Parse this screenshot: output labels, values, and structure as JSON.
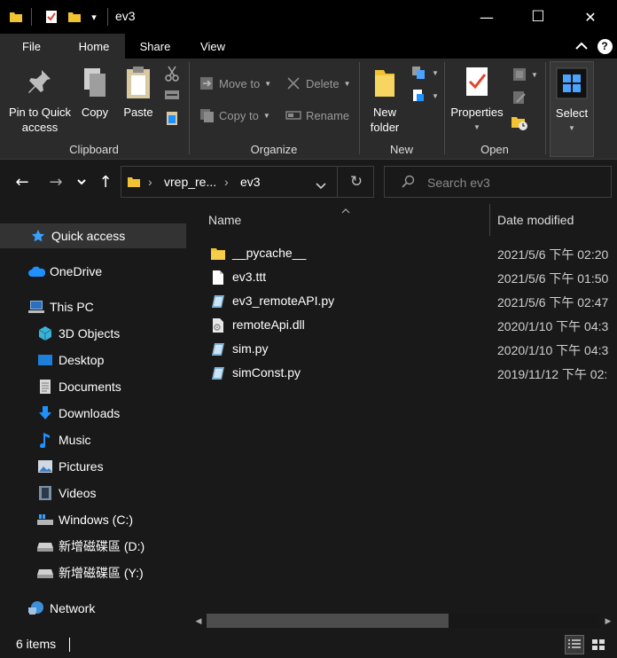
{
  "window": {
    "title": "ev3",
    "minimize_glyph": "—",
    "maximize_glyph": "☐",
    "close_glyph": "✕"
  },
  "quick_access_toolbar": {
    "icons": [
      "folder-icon",
      "properties-check-icon",
      "new-folder-icon",
      "customize-dropdown-icon"
    ],
    "customize_glyph": "▾"
  },
  "tabs": [
    {
      "label": "File"
    },
    {
      "label": "Home"
    },
    {
      "label": "Share"
    },
    {
      "label": "View"
    }
  ],
  "ribbon_controls": {
    "collapse_glyph": "^",
    "help_glyph": "?"
  },
  "ribbon": {
    "clipboard": {
      "label": "Clipboard",
      "pin_label": "Pin to Quick access",
      "copy_label": "Copy",
      "paste_label": "Paste"
    },
    "organize": {
      "label": "Organize",
      "move_to": "Move to",
      "copy_to": "Copy to",
      "delete": "Delete",
      "rename": "Rename"
    },
    "new": {
      "label": "New",
      "new_folder": "New folder"
    },
    "open": {
      "label": "Open",
      "properties": "Properties"
    },
    "select": {
      "label": "Select"
    }
  },
  "navigation": {
    "back_glyph": "←",
    "forward_glyph": "→",
    "recent_glyph": "⌄",
    "up_glyph": "↑",
    "breadcrumb": [
      "vrep_re...",
      "ev3"
    ],
    "breadcrumb_sep": "›",
    "refresh_glyph": "↻",
    "search_placeholder": "Search ev3"
  },
  "nav_pane": {
    "items": [
      {
        "label": "Quick access",
        "icon": "star-icon"
      },
      {
        "label": "OneDrive",
        "icon": "cloud-icon"
      },
      {
        "label": "This PC",
        "icon": "computer-icon"
      },
      {
        "label": "3D Objects",
        "icon": "cube-icon"
      },
      {
        "label": "Desktop",
        "icon": "desktop-icon"
      },
      {
        "label": "Documents",
        "icon": "document-icon"
      },
      {
        "label": "Downloads",
        "icon": "download-icon"
      },
      {
        "label": "Music",
        "icon": "music-icon"
      },
      {
        "label": "Pictures",
        "icon": "pictures-icon"
      },
      {
        "label": "Videos",
        "icon": "video-icon"
      },
      {
        "label": "Windows (C:)",
        "icon": "drive-c-icon"
      },
      {
        "label": "新增磁碟區 (D:)",
        "icon": "drive-icon"
      },
      {
        "label": "新增磁碟區 (Y:)",
        "icon": "drive-icon"
      },
      {
        "label": "Network",
        "icon": "network-icon"
      }
    ]
  },
  "columns": {
    "name": "Name",
    "date_modified": "Date modified",
    "sort_glyph": "^"
  },
  "files": [
    {
      "name": "__pycache__",
      "date": "2021/5/6 下午 02:20",
      "icon": "folder-icon"
    },
    {
      "name": "ev3.ttt",
      "date": "2021/5/6 下午 01:50",
      "icon": "file-icon"
    },
    {
      "name": "ev3_remoteAPI.py",
      "date": "2021/5/6 下午 02:47",
      "icon": "python-file-icon"
    },
    {
      "name": "remoteApi.dll",
      "date": "2020/1/10 下午 04:3",
      "icon": "dll-file-icon"
    },
    {
      "name": "sim.py",
      "date": "2020/1/10 下午 04:3",
      "icon": "python-file-icon"
    },
    {
      "name": "simConst.py",
      "date": "2019/11/12 下午 02:",
      "icon": "python-file-icon"
    }
  ],
  "scrollbar": {
    "left_glyph": "◀",
    "right_glyph": "▶",
    "position": 0.0
  },
  "status": {
    "item_count": "6 items"
  },
  "colors": {
    "titlebar": "#000000",
    "ribbon": "#2b2b2b",
    "background": "#191919",
    "folder": "#f1c232",
    "accent_blue": "#1e90ff"
  }
}
